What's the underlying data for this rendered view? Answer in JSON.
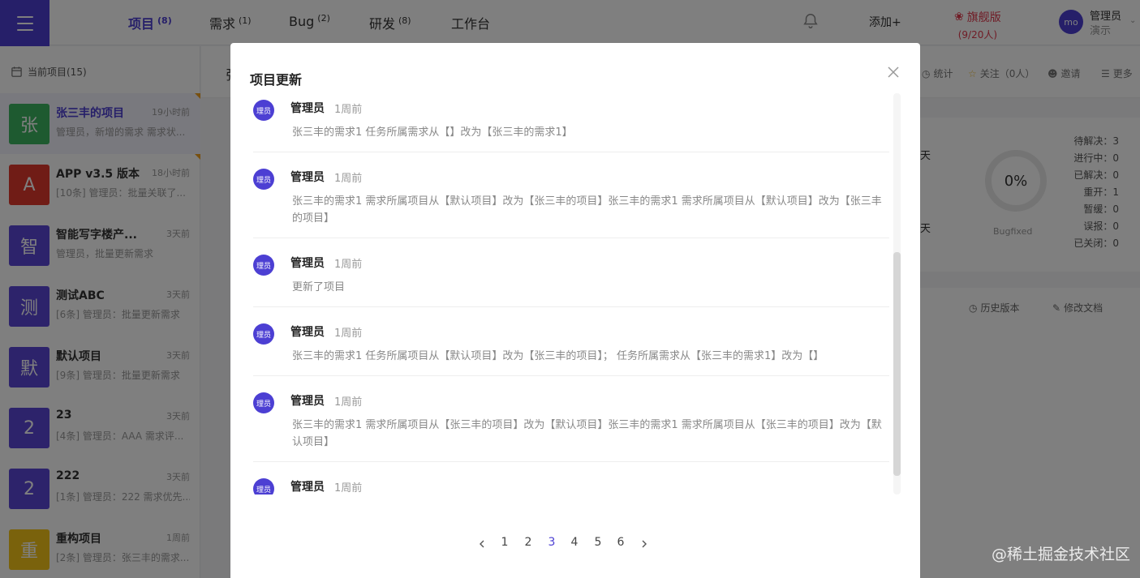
{
  "nav": {
    "tabs": [
      {
        "label": "项目",
        "count": "(8)"
      },
      {
        "label": "需求",
        "count": "(1)"
      },
      {
        "label": "Bug",
        "count": "(2)"
      },
      {
        "label": "研发",
        "count": "(8)"
      },
      {
        "label": "工作台",
        "count": ""
      }
    ],
    "add_label": "添加+",
    "edition_label": "旗舰版",
    "edition_seats": "(9/20人)",
    "user_avatar": "mo",
    "user_name": "管理员",
    "user_role": "演示"
  },
  "sidebar": {
    "header": "当前项目(15)",
    "projects": [
      {
        "avatar": "张",
        "color": "#3cb460",
        "name": "张三丰的项目",
        "time": "19小时前",
        "desc": "管理员，新增的需求 需求状..."
      },
      {
        "avatar": "A",
        "color": "#e0382c",
        "name": "APP v3.5 版本",
        "time": "18小时前",
        "desc": "[10条] 管理员：批量关联了..."
      },
      {
        "avatar": "智",
        "color": "#5b46d6",
        "name": "智能写字楼产...",
        "time": "3天前",
        "desc": "管理员，批量更新需求"
      },
      {
        "avatar": "测",
        "color": "#5b46d6",
        "name": "测试ABC",
        "time": "3天前",
        "desc": "[6条] 管理员：批量更新需求"
      },
      {
        "avatar": "默",
        "color": "#5b46d6",
        "name": "默认项目",
        "time": "3天前",
        "desc": "[9条] 管理员：批量更新需求"
      },
      {
        "avatar": "2",
        "color": "#5b46d6",
        "name": "23",
        "time": "3天前",
        "desc": "[4条] 管理员：AAA 需求评..."
      },
      {
        "avatar": "2",
        "color": "#5b46d6",
        "name": "222",
        "time": "3天前",
        "desc": "[1条] 管理员：222 需求优先..."
      },
      {
        "avatar": "重",
        "color": "#f5c518",
        "name": "重构项目",
        "time": "1周前",
        "desc": "[2条] 管理员：张三丰的需求..."
      }
    ]
  },
  "main": {
    "title_partial": "张",
    "actions": {
      "stats": "统计",
      "follow": "关注（0人）",
      "invite": "邀请",
      "more": "更多"
    },
    "bug_ring": {
      "percent": "0%",
      "label": "Bugfixed"
    },
    "stats": [
      {
        "label": "待解决：",
        "value": "3"
      },
      {
        "label": "进行中：",
        "value": "0"
      },
      {
        "label": "已解决：",
        "value": "0"
      },
      {
        "label": "重开：",
        "value": "1"
      },
      {
        "label": "暂缓：",
        "value": "0"
      },
      {
        "label": "误报：",
        "value": "0"
      },
      {
        "label": "已关闭：",
        "value": "0"
      }
    ],
    "side_fragment": "天",
    "doc_actions": {
      "history": "历史版本",
      "edit": "修改文档"
    }
  },
  "modal": {
    "title": "项目更新",
    "entries": [
      {
        "avatar": "理员",
        "user": "管理员",
        "time": "1周前",
        "text": "张三丰的需求1 任务所属需求从【】改为【张三丰的需求1】"
      },
      {
        "avatar": "理员",
        "user": "管理员",
        "time": "1周前",
        "text": "张三丰的需求1 需求所属项目从【默认项目】改为【张三丰的项目】张三丰的需求1 需求所属项目从【默认项目】改为【张三丰的项目】"
      },
      {
        "avatar": "理员",
        "user": "管理员",
        "time": "1周前",
        "text": "更新了项目"
      },
      {
        "avatar": "理员",
        "user": "管理员",
        "time": "1周前",
        "text": "张三丰的需求1 任务所属项目从【默认项目】改为【张三丰的项目】； 任务所属需求从【张三丰的需求1】改为【】"
      },
      {
        "avatar": "理员",
        "user": "管理员",
        "time": "1周前",
        "text": "张三丰的需求1 需求所属项目从【张三丰的项目】改为【默认项目】张三丰的需求1 需求所属项目从【张三丰的项目】改为【默认项目】"
      },
      {
        "avatar": "理员",
        "user": "管理员",
        "time": "1周前",
        "text": ""
      }
    ],
    "pagination": {
      "pages": [
        "1",
        "2",
        "3",
        "4",
        "5",
        "6"
      ],
      "current": "3"
    }
  },
  "watermark": "@稀土掘金技术社区",
  "colors": {
    "accent": "#4c3fd3",
    "edition": "#e0384c"
  }
}
